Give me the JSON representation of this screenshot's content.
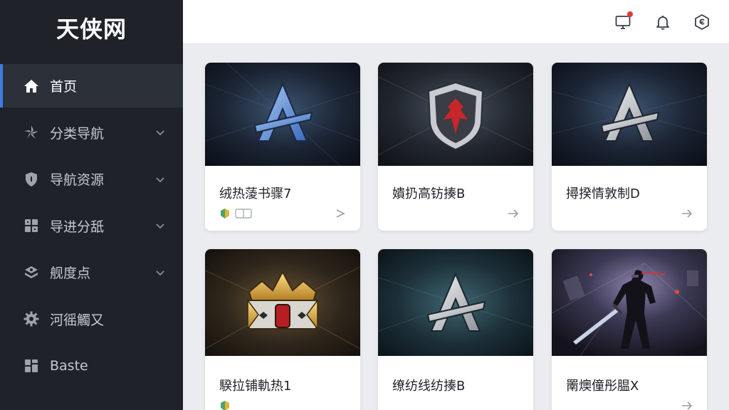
{
  "app": {
    "title": "天侠网"
  },
  "sidebar": {
    "items": [
      {
        "label": "首页",
        "icon": "home-icon",
        "active": true,
        "has_submenu": false
      },
      {
        "label": "分类导航",
        "icon": "category-icon",
        "active": false,
        "has_submenu": true
      },
      {
        "label": "导航资源",
        "icon": "shield-icon",
        "active": false,
        "has_submenu": true
      },
      {
        "label": "导进分舐",
        "icon": "grid-icon",
        "active": false,
        "has_submenu": true
      },
      {
        "label": "舰度点",
        "icon": "layers-icon",
        "active": false,
        "has_submenu": true
      },
      {
        "label": "河徭觸又",
        "icon": "gear-icon",
        "active": false,
        "has_submenu": false
      },
      {
        "label": "Baste",
        "icon": "apps-icon",
        "active": false,
        "has_submenu": false
      }
    ]
  },
  "topbar": {
    "icons": [
      "monitor-icon",
      "bell-icon",
      "hexagon-settings-icon"
    ],
    "notification_dot_color": "#e53935"
  },
  "cards": [
    {
      "title": "绒热蔆书骤7",
      "image": "blue-emblem-A",
      "has_meta": true
    },
    {
      "title": "嬇扔高钫揍B",
      "image": "red-shield-emblem",
      "has_meta": false
    },
    {
      "title": "撏揆情敦制D",
      "image": "silver-emblem-A",
      "has_meta": false
    },
    {
      "title": "騤拉铺軌热1",
      "image": "golden-crown",
      "has_meta": true
    },
    {
      "title": "缭纺线纺揍B",
      "image": "teal-emblem-A",
      "has_meta": false
    },
    {
      "title": "罱燠僮彤腽X",
      "image": "ninja-warrior",
      "has_meta": false
    }
  ],
  "colors": {
    "sidebar_bg": "#1f2229",
    "accent": "#3d7be0",
    "content_bg": "#ebecef"
  }
}
